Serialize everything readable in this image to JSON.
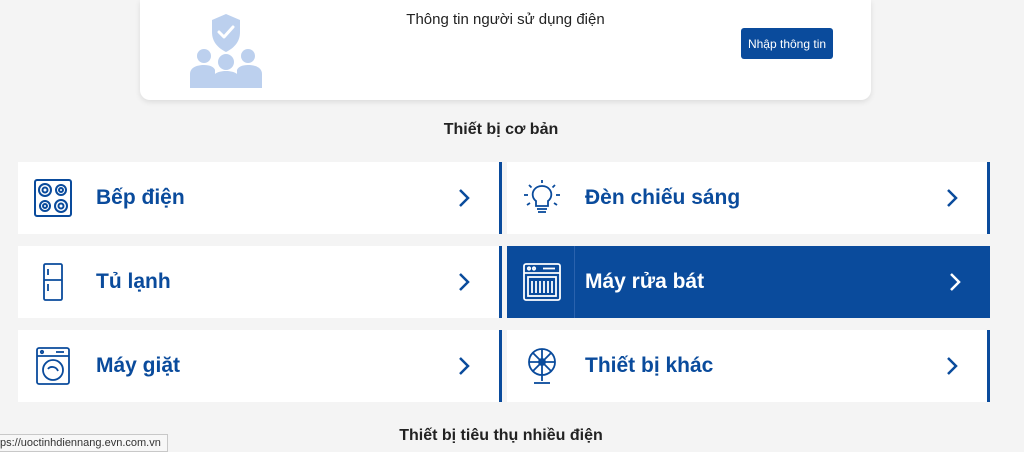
{
  "user_info": {
    "title": "Thông tin người sử dụng điện",
    "button_label": "Nhập thông tin",
    "icon": "users-shield-icon"
  },
  "sections": {
    "basic_title": "Thiết bị cơ bản",
    "high_consumption_title": "Thiết bị tiêu thụ nhiều điện"
  },
  "devices": [
    {
      "label": "Bếp điện",
      "icon": "stove-icon",
      "active": false
    },
    {
      "label": "Đèn chiếu sáng",
      "icon": "lightbulb-icon",
      "active": false
    },
    {
      "label": "Tủ lạnh",
      "icon": "fridge-icon",
      "active": false
    },
    {
      "label": "Máy rửa bát",
      "icon": "dishwasher-icon",
      "active": true
    },
    {
      "label": "Máy giặt",
      "icon": "washing-machine-icon",
      "active": false
    },
    {
      "label": "Thiết bị khác",
      "icon": "fan-icon",
      "active": false
    }
  ],
  "status_bar": {
    "url": "ps://uoctinhdiennang.evn.com.vn"
  },
  "colors": {
    "accent": "#0a4b9c",
    "background": "#f4f4f4",
    "icon_light": "#bcd0ee"
  }
}
